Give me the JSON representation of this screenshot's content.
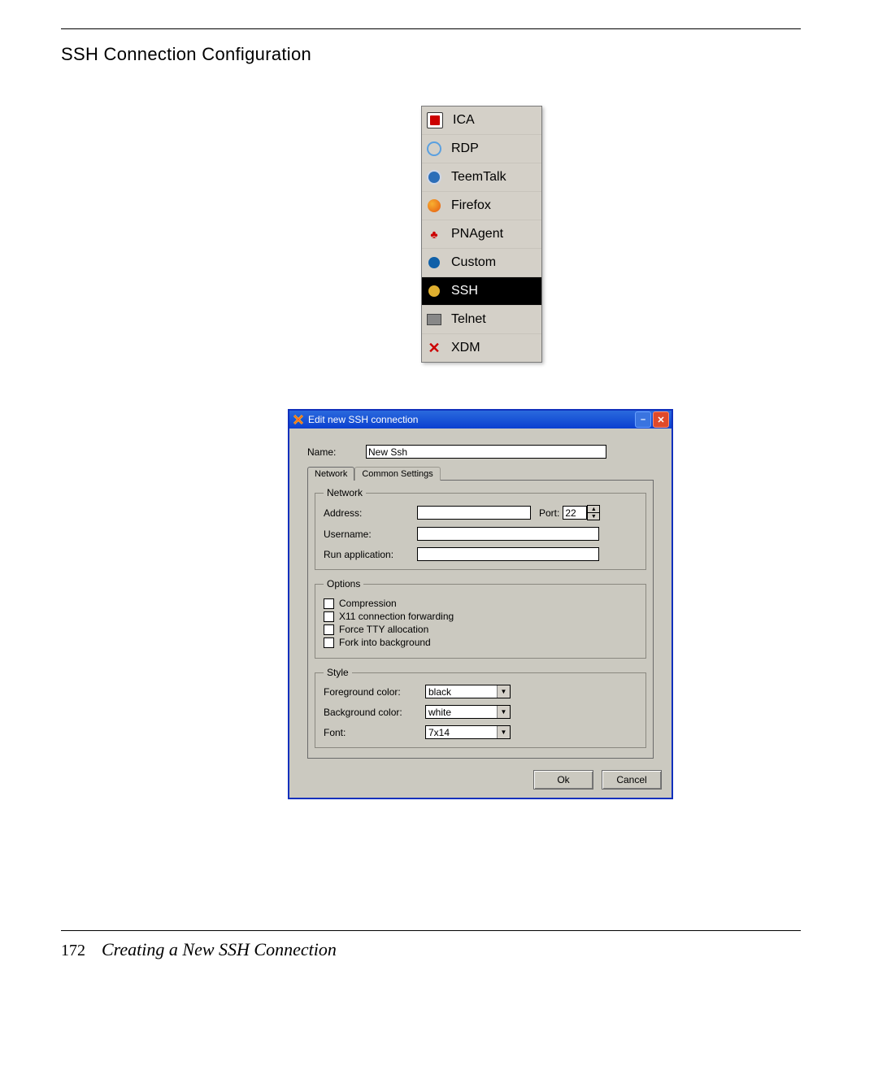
{
  "section_title": "SSH Connection Configuration",
  "menu": {
    "items": [
      {
        "label": "ICA",
        "icon": "ica-icon"
      },
      {
        "label": "RDP",
        "icon": "rdp-icon"
      },
      {
        "label": "TeemTalk",
        "icon": "teemtalk-icon"
      },
      {
        "label": "Firefox",
        "icon": "firefox-icon"
      },
      {
        "label": "PNAgent",
        "icon": "pnagent-icon"
      },
      {
        "label": "Custom",
        "icon": "custom-icon"
      },
      {
        "label": "SSH",
        "icon": "ssh-icon"
      },
      {
        "label": "Telnet",
        "icon": "telnet-icon"
      },
      {
        "label": "XDM",
        "icon": "xdm-icon"
      }
    ],
    "selected_index": 6
  },
  "dialog": {
    "title": "Edit new SSH connection",
    "name_label": "Name:",
    "name_value": "New Ssh",
    "tabs": {
      "network": "Network",
      "common": "Common Settings"
    },
    "network_group": {
      "legend": "Network",
      "address_label": "Address:",
      "address_value": "",
      "port_label": "Port:",
      "port_value": "22",
      "username_label": "Username:",
      "username_value": "",
      "runapp_label": "Run application:",
      "runapp_value": ""
    },
    "options_group": {
      "legend": "Options",
      "compression": "Compression",
      "x11": "X11 connection forwarding",
      "force_tty": "Force TTY allocation",
      "fork_bg": "Fork into background"
    },
    "style_group": {
      "legend": "Style",
      "fg_label": "Foreground color:",
      "fg_value": "black",
      "bg_label": "Background color:",
      "bg_value": "white",
      "font_label": "Font:",
      "font_value": "7x14"
    },
    "buttons": {
      "ok": "Ok",
      "cancel": "Cancel"
    }
  },
  "footer": {
    "page_number": "172",
    "caption": "Creating a New SSH Connection"
  }
}
